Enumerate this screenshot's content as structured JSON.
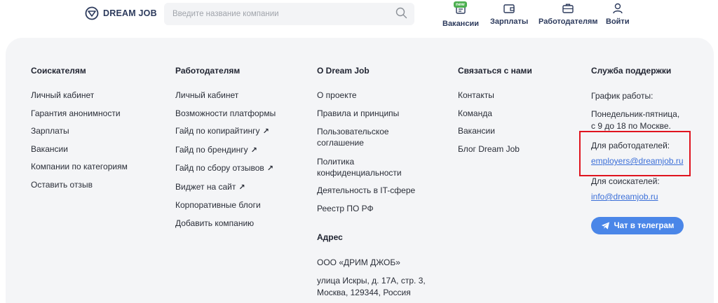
{
  "header": {
    "logo_text": "DREAM JOB",
    "search_placeholder": "Введите название компании",
    "nav": [
      {
        "label": "Вакансии",
        "badge": "new"
      },
      {
        "label": "Зарплаты"
      },
      {
        "label": "Работодателям"
      },
      {
        "label": "Войти"
      }
    ]
  },
  "footer": {
    "col1": {
      "title": "Соискателям",
      "items": [
        "Личный кабинет",
        "Гарантия анонимности",
        "Зарплаты",
        "Вакансии",
        "Компании по категориям",
        "Оставить отзыв"
      ]
    },
    "col2": {
      "title": "Работодателям",
      "items": [
        "Личный кабинет",
        "Возможности платформы",
        "Гайд по копирайтингу",
        "Гайд по брендингу",
        "Гайд по сбору отзывов",
        "Виджет на сайт",
        "Корпоративные блоги",
        "Добавить компанию"
      ]
    },
    "col3": {
      "title": "О Dream Job",
      "items": [
        "О проекте",
        "Правила и принципы"
      ],
      "item3_line1": "Пользовательское",
      "item3_line2": "соглашение",
      "item4_line1": "Политика",
      "item4_line2": "конфиденциальности",
      "item5": "Деятельность в IT-сфере",
      "item6": "Реестр ПО РФ",
      "address_title": "Адрес",
      "company": "ООО «ДРИМ ДЖОБ»",
      "address_line1": "улица Искры, д. 17А, стр. 3,",
      "address_line2": "Москва, 129344, Россия"
    },
    "col4": {
      "title": "Связаться с нами",
      "items": [
        "Контакты",
        "Команда",
        "Вакансии",
        "Блог Dream Job"
      ]
    },
    "col5": {
      "title": "Служба поддержки",
      "schedule_label": "График работы:",
      "schedule_line1": "Понедельник-пятница,",
      "schedule_line2": "с 9 до 18 по Москве.",
      "employers_label": "Для работодателей:",
      "employers_email": "employers@dreamjob.ru",
      "seekers_label": "Для соискателей:",
      "seekers_email": "info@dreamjob.ru",
      "telegram_button": "Чат в телеграм"
    }
  }
}
